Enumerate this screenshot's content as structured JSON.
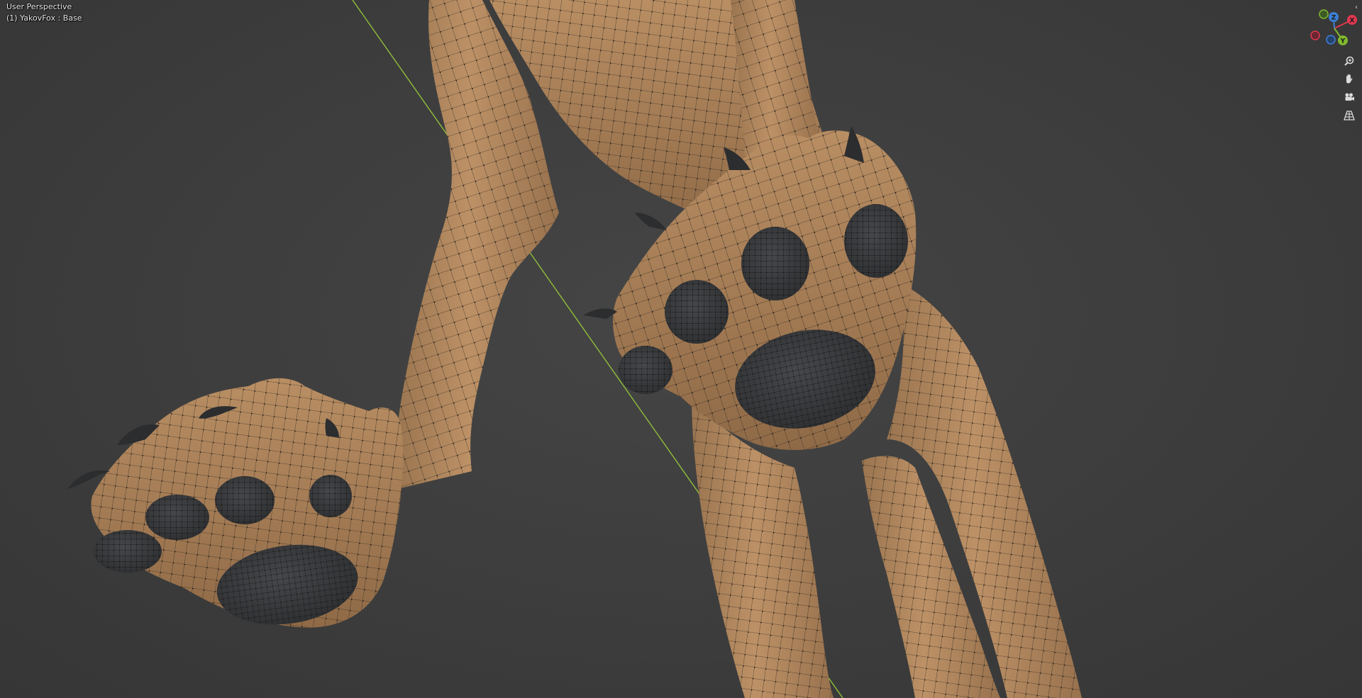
{
  "viewport": {
    "view_name": "User Perspective",
    "object_info": "(1) YakovFox : Base"
  },
  "gizmo": {
    "axes": [
      {
        "label": "X",
        "color": "#e0384f"
      },
      {
        "label": "Y",
        "color": "#7fb82f"
      },
      {
        "label": "Z",
        "color": "#3d7fd4"
      }
    ]
  },
  "navigation": {
    "icons": [
      "zoom-icon",
      "hand-pan-icon",
      "camera-icon",
      "grid-perspective-icon"
    ]
  },
  "colors": {
    "background": "#3d3d3d",
    "skin": "#b48960",
    "skin_dark": "#8f6a47",
    "pad": "#3a3b3c",
    "wire": "#151515",
    "axis_line": "#8fbf3a"
  }
}
